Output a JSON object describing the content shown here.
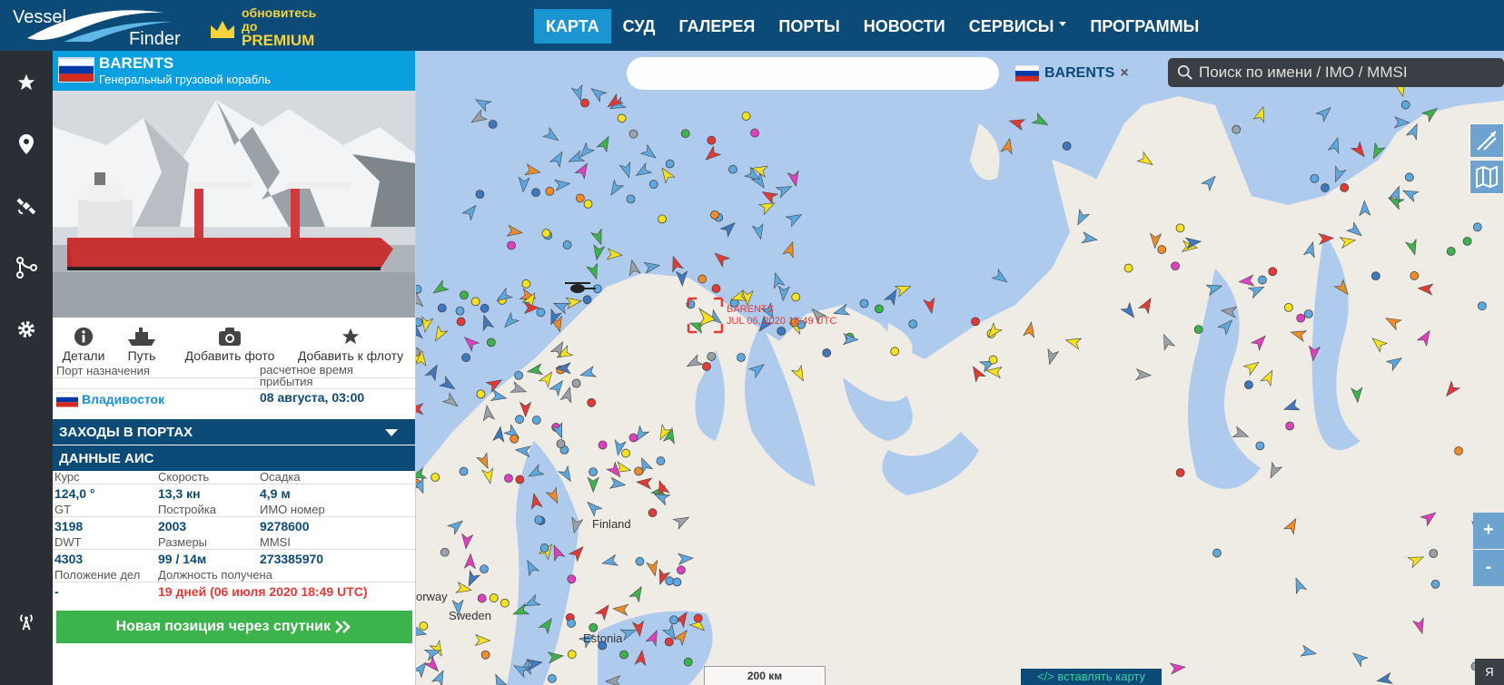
{
  "header": {
    "logo_top": "Vessel",
    "logo_bottom": "Finder",
    "premium_line1": "обновитесь",
    "premium_line2": "до",
    "premium_line3": "PREMIUM",
    "nav": [
      "КАРТА",
      "СУД",
      "ГАЛЕРЕЯ",
      "ПОРТЫ",
      "НОВОСТИ",
      "СЕРВИСЫ",
      "ПРОГРАММЫ"
    ]
  },
  "vessel": {
    "name": "BARENTS",
    "type": "Генеральный грузовой корабль"
  },
  "actions": [
    "Детали",
    "Путь",
    "Добавить фото",
    "Добавить к флоту"
  ],
  "destination": {
    "port_label": "Порт назначения",
    "eta_label": "расчетное время прибытия",
    "port": "Владивосток",
    "eta": "08 августа, 03:00"
  },
  "sections": {
    "port_calls": "ЗАХОДЫ В ПОРТАХ",
    "ais": "ДАННЫЕ АИС"
  },
  "ais": {
    "course_label": "Курс",
    "course": "124,0 °",
    "speed_label": "Скорость",
    "speed": "13,3 кн",
    "draught_label": "Осадка",
    "draught": "4,9 м",
    "gt_label": "GT",
    "gt": "3198",
    "built_label": "Постройка",
    "built": "2003",
    "imo_label": "ИМО номер",
    "imo": "9278600",
    "dwt_label": "DWT",
    "dwt": "4303",
    "size_label": "Размеры",
    "size": "99 / 14м",
    "mmsi_label": "MMSI",
    "mmsi": "273385970",
    "status_label": "Положение дел",
    "status": "-",
    "received_label": "Должность получена",
    "received": "19 дней (06 июля 2020 18:49 UTC)"
  },
  "satellite_button": "Новая позиция через спутник",
  "map": {
    "search_placeholder": "Поиск по имени / IMO / MMSI",
    "tag_name": "BARENTS",
    "tag_close": "×",
    "ship_label_name": "BARENTS",
    "ship_label_time": "JUL 06, 2020 18:49 UTC",
    "place_finland": "Finland",
    "place_norway": "orway",
    "place_sweden": "Sweden",
    "place_estonia": "Estonia",
    "scale": "200 км",
    "embed": "</> вставлять карту",
    "zoom_in": "+",
    "zoom_out": "-",
    "yandex": "Я"
  },
  "colors": {
    "header": "#0c4a78",
    "accent": "#1a95d2",
    "panel_header": "#0aa0e0",
    "green_button": "#3cb44b",
    "water": "#aecbed",
    "land": "#efece6",
    "alert_red": "#e53935"
  }
}
